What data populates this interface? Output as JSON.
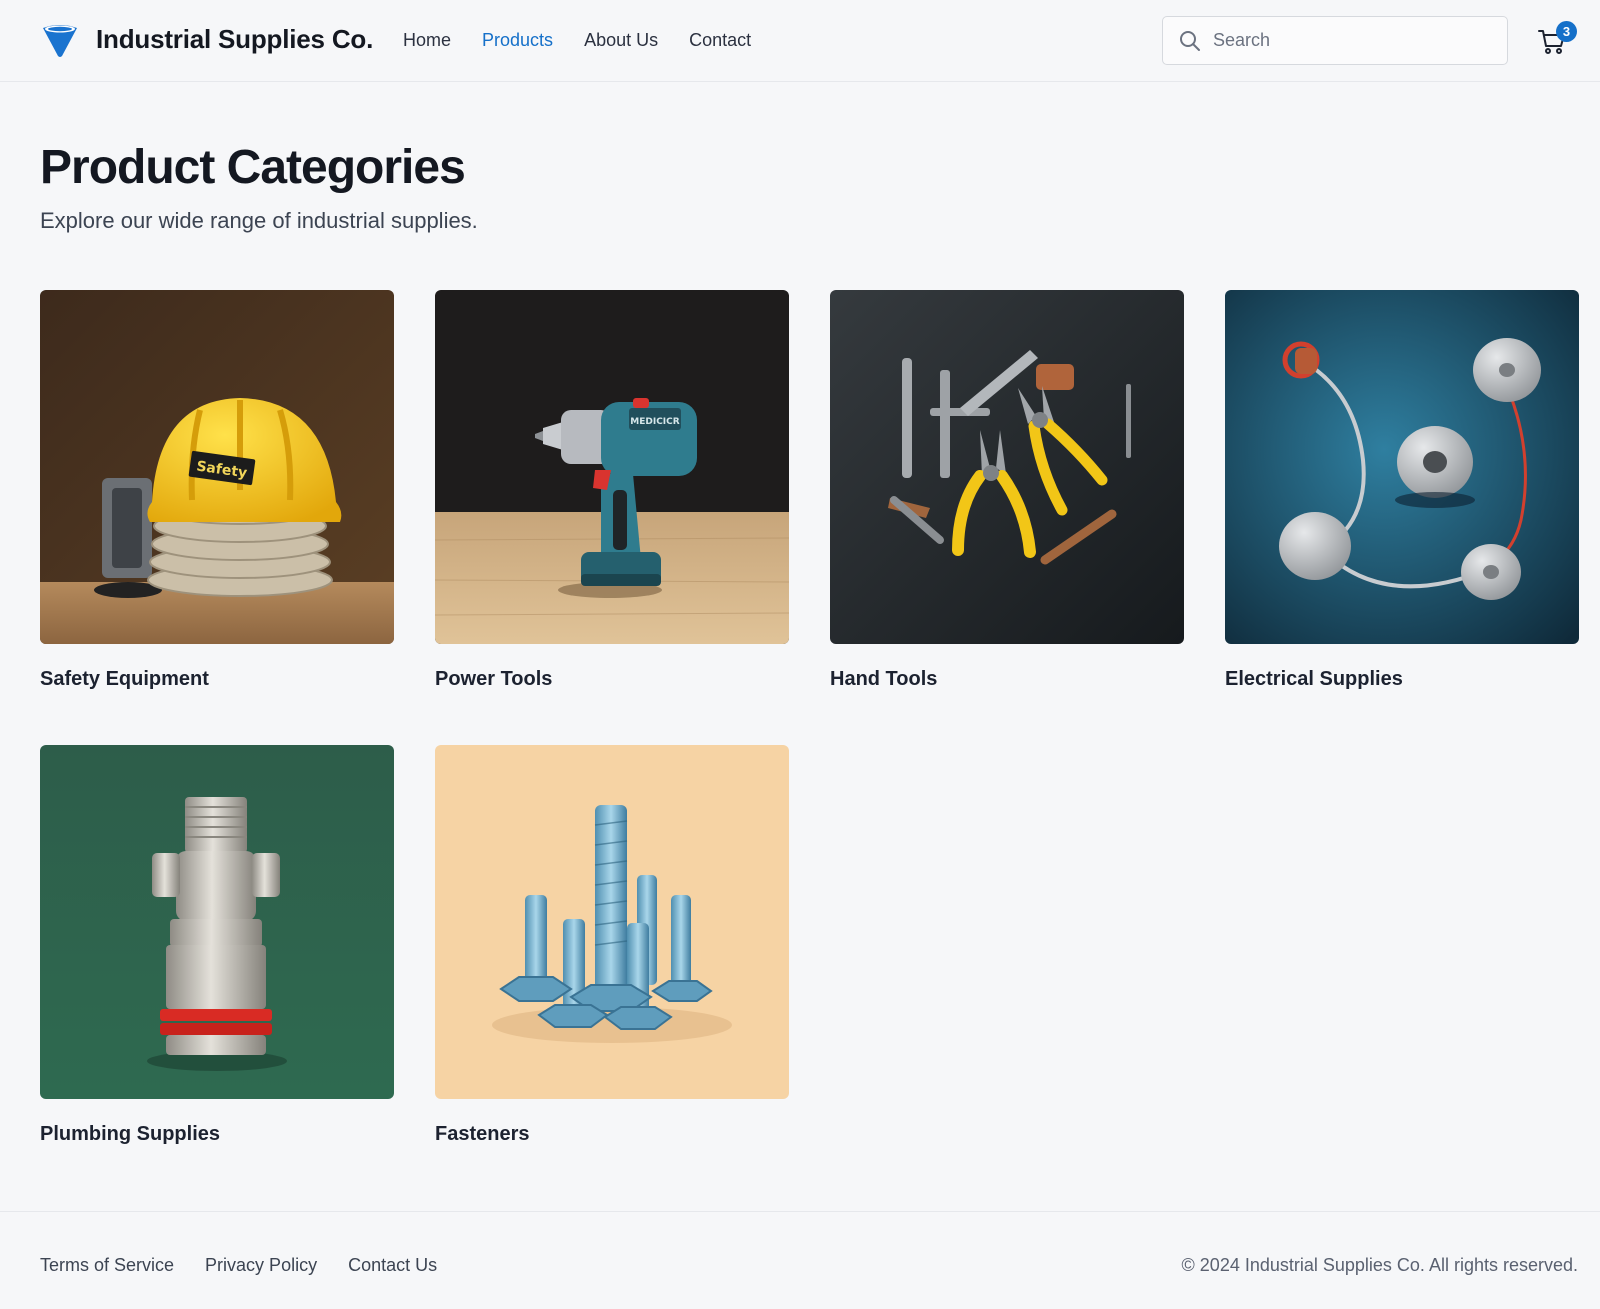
{
  "header": {
    "brand": "Industrial Supplies Co.",
    "logo_icon": "funnel-logo-icon",
    "nav": [
      {
        "label": "Home",
        "active": false
      },
      {
        "label": "Products",
        "active": true
      },
      {
        "label": "About Us",
        "active": false
      },
      {
        "label": "Contact",
        "active": false
      }
    ],
    "search": {
      "placeholder": "Search",
      "value": "",
      "icon": "search-icon"
    },
    "cart": {
      "icon": "cart-icon",
      "count": "3"
    }
  },
  "main": {
    "title": "Product Categories",
    "subtitle": "Explore our wide range of industrial supplies.",
    "categories": [
      {
        "name": "Safety Equipment",
        "image": "hard-hat-image"
      },
      {
        "name": "Power Tools",
        "image": "drill-image"
      },
      {
        "name": "Hand Tools",
        "image": "pliers-image"
      },
      {
        "name": "Electrical Supplies",
        "image": "electrical-parts-image"
      },
      {
        "name": "Plumbing Supplies",
        "image": "valve-image"
      },
      {
        "name": "Fasteners",
        "image": "bolts-image"
      }
    ]
  },
  "footer": {
    "links": [
      "Terms of Service",
      "Privacy Policy",
      "Contact Us"
    ],
    "copyright": "© 2024 Industrial Supplies Co. All rights reserved."
  },
  "colors": {
    "accent": "#1570c9",
    "background": "#f6f7f9",
    "text": "#141821"
  }
}
